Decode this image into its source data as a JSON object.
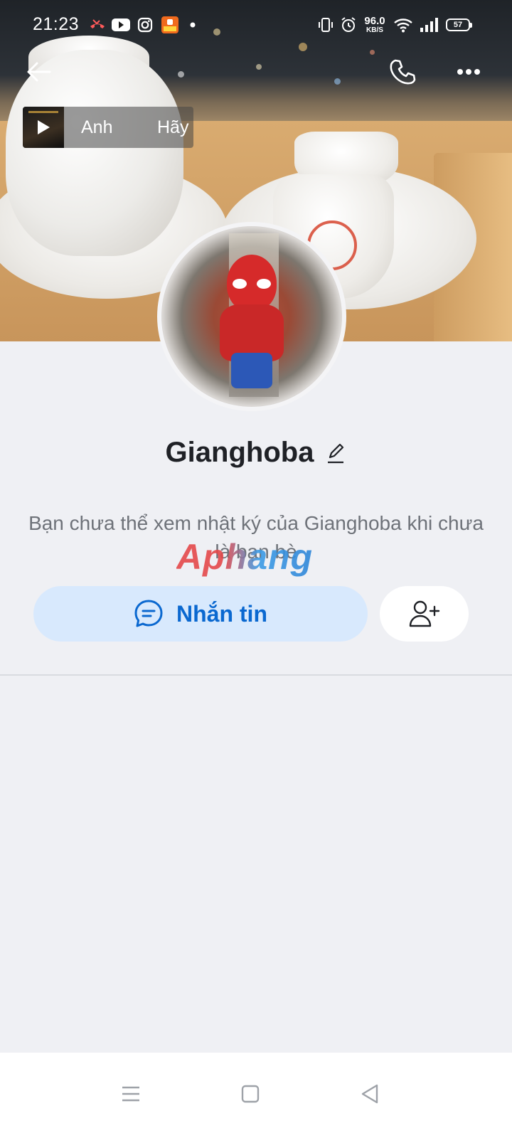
{
  "status_bar": {
    "time": "21:23",
    "net_speed_value": "96.0",
    "net_speed_unit": "KB/S",
    "battery": "57",
    "notification_icons": [
      "missed-call-icon",
      "youtube-icon",
      "instagram-icon",
      "shopping-app-icon",
      "dot-icon"
    ],
    "system_icons": [
      "vibrate-icon",
      "alarm-icon",
      "wifi-icon",
      "signal-icon",
      "battery-icon"
    ]
  },
  "header": {
    "back_icon": "arrow-left-icon",
    "call_icon": "phone-icon",
    "more_icon": "more-dots-icon"
  },
  "music": {
    "title": "Anh         Hãy"
  },
  "profile": {
    "name": "Gianghoba",
    "edit_icon": "pencil-icon",
    "notice": "Bạn chưa thể xem nhật ký của Gianghoba khi chưa là bạn bè"
  },
  "watermark": "Aphang",
  "actions": {
    "message_label": "Nhắn tin",
    "message_icon": "chat-bubble-icon",
    "add_friend_icon": "add-user-icon"
  },
  "colors": {
    "accent": "#0a68d0",
    "accent_bg": "#d8e9fd",
    "page_bg": "#eff0f4"
  }
}
